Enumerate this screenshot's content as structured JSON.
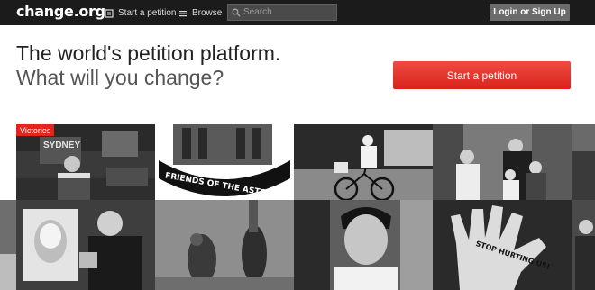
{
  "header": {
    "logo": "change.org",
    "nav": [
      {
        "label": "Start a petition",
        "icon": "petition-icon"
      },
      {
        "label": "Browse",
        "icon": "list-icon"
      }
    ],
    "search": {
      "placeholder": "Search",
      "icon": "search-icon"
    },
    "login_label": "Login or Sign Up"
  },
  "hero": {
    "title": "The world's petition platform.",
    "subtitle": "What will you change?",
    "cta_label": "Start a petition"
  },
  "gallery": {
    "badge": "Victories",
    "sign_sydney": "SYDNEY",
    "sign_astor": "FRIENDS OF THE ASTOR",
    "sign_stop": "STOP HURTING US!"
  },
  "colors": {
    "topbar": "#1b1b1b",
    "accent": "#e2251d",
    "login_button": "#6b6b6b"
  }
}
